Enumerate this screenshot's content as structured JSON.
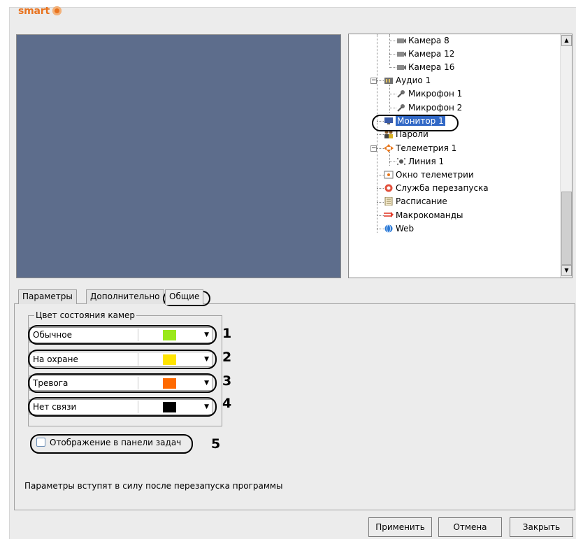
{
  "brand": {
    "name": "smart"
  },
  "tree": {
    "items": [
      {
        "label": "Камера 8",
        "icon": "camera-icon"
      },
      {
        "label": "Камера 12",
        "icon": "camera-icon"
      },
      {
        "label": "Камера 16",
        "icon": "camera-icon"
      },
      {
        "label": "Аудио 1",
        "icon": "audio-device-icon"
      },
      {
        "label": "Микрофон 1",
        "icon": "microphone-icon"
      },
      {
        "label": "Микрофон 2",
        "icon": "microphone-icon"
      },
      {
        "label": "Монитор 1",
        "icon": "monitor-icon"
      },
      {
        "label": "Пароли",
        "icon": "users-icon"
      },
      {
        "label": "Телеметрия 1",
        "icon": "telemetry-icon"
      },
      {
        "label": "Линия 1",
        "icon": "line-icon"
      },
      {
        "label": "Окно телеметрии",
        "icon": "telemetry-window-icon"
      },
      {
        "label": "Служба перезапуска",
        "icon": "restart-service-icon"
      },
      {
        "label": "Расписание",
        "icon": "schedule-icon"
      },
      {
        "label": "Макрокоманды",
        "icon": "macro-icon"
      },
      {
        "label": "Web",
        "icon": "web-icon"
      }
    ]
  },
  "tabs": [
    {
      "label": "Параметры"
    },
    {
      "label": "Дополнительно"
    },
    {
      "label": "Общие"
    }
  ],
  "group": {
    "title": "Цвет состояния камер",
    "rows": [
      {
        "label": "Обычное",
        "color": "#99e81a",
        "marker": "1"
      },
      {
        "label": "На охране",
        "color": "#ffe400",
        "marker": "2"
      },
      {
        "label": "Тревога",
        "color": "#ff6a00",
        "marker": "3"
      },
      {
        "label": "Нет связи",
        "color": "#000000",
        "marker": "4"
      }
    ]
  },
  "checkbox": {
    "label": "Отображение в панели задач",
    "checked": false,
    "marker": "5"
  },
  "note": "Параметры вступят в силу после перезапуска программы",
  "buttons": {
    "apply": "Применить",
    "cancel": "Отмена",
    "close": "Закрыть"
  }
}
